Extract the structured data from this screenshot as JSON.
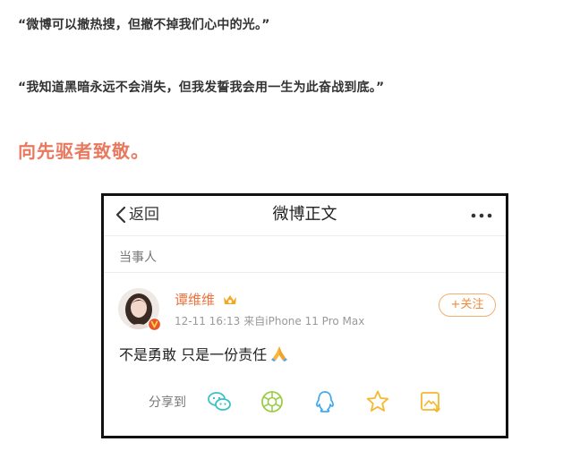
{
  "article": {
    "quote_1": "“微博可以撤热搜，但撤不掉我们心中的光。”",
    "quote_2": "“我知道黑暗永远不会消失，但我发誓我会用一生为此奋战到底。”",
    "tribute": "向先驱者致敬。"
  },
  "weibo": {
    "nav": {
      "back_label": "返回",
      "title": "微博正文"
    },
    "section_label": "当事人",
    "post": {
      "username": "谭维维",
      "date": "12-11 16:13",
      "source": "来自iPhone 11 Pro Max",
      "follow_label": "+关注",
      "content": "不是勇敢 只是一份责任"
    },
    "share": {
      "label": "分享到",
      "icons": [
        "wechat-icon",
        "moments-icon",
        "qq-icon",
        "favorite-star-icon",
        "image-save-icon"
      ]
    },
    "colors": {
      "accent_orange": "#eb7340",
      "tribute_salmon": "#e8795f",
      "share_teal": "#3cc0c8",
      "share_green": "#9ccc4c",
      "share_blue": "#3fa9f0",
      "share_yellow": "#f5b82e"
    }
  }
}
